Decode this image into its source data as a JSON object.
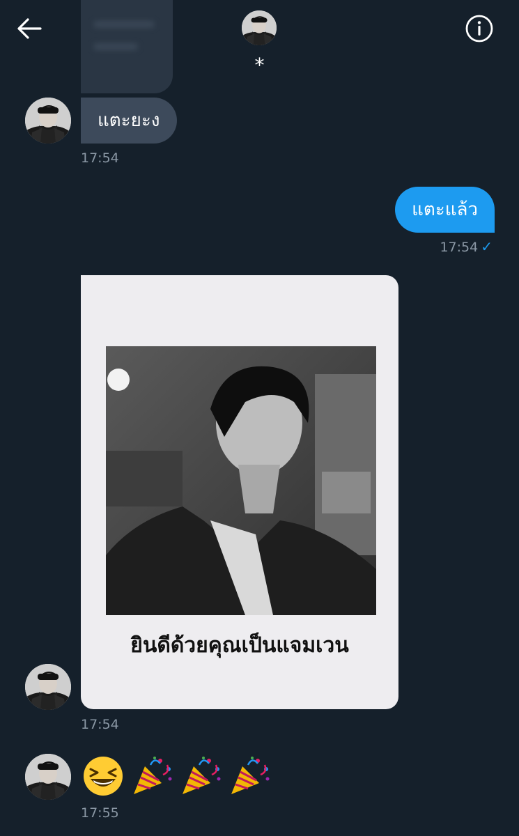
{
  "header": {
    "contact_name": "*",
    "back_icon": "arrow-left-icon",
    "info_icon": "info-circle-icon"
  },
  "messages": [
    {
      "id": "m1",
      "direction": "incoming",
      "type": "text",
      "text": "แตะยะง",
      "time": "17:54"
    },
    {
      "id": "m2",
      "direction": "outgoing",
      "type": "text",
      "text": "แตะแล้ว",
      "time": "17:54",
      "status": "✓"
    },
    {
      "id": "m3",
      "direction": "incoming",
      "type": "image",
      "caption": "ยินดีด้วยคุณเป็นแจมเวน",
      "time": "17:54"
    },
    {
      "id": "m4",
      "direction": "incoming",
      "type": "emoji",
      "emoji": [
        "grinning-squinting-face",
        "party-popper",
        "party-popper",
        "party-popper"
      ],
      "time": "17:55"
    }
  ],
  "colors": {
    "background": "#15202b",
    "incoming_bubble": "#3d4a5b",
    "outgoing_bubble": "#1d9bf0",
    "timestamp": "#8b98a5",
    "image_card": "#eeedf0"
  }
}
